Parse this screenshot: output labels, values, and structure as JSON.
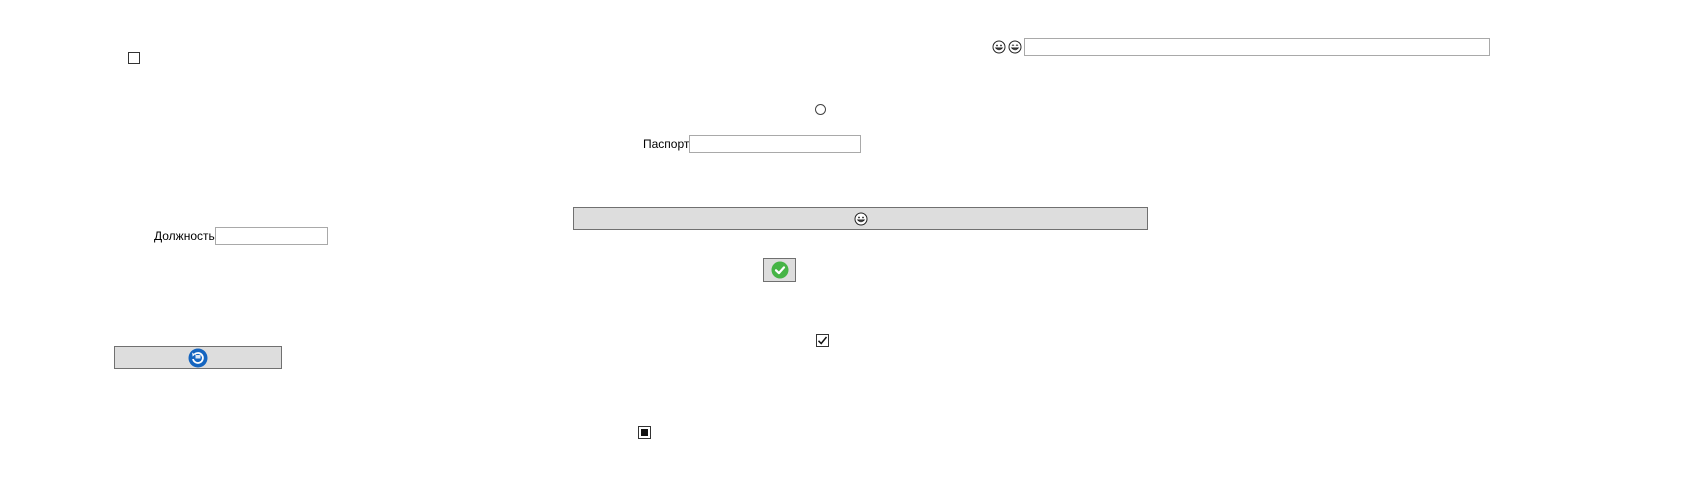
{
  "checkbox_top_left": {
    "checked": false
  },
  "radio_center": {
    "selected": false
  },
  "passport": {
    "label": "Паспорт",
    "value": ""
  },
  "position": {
    "label": "Должность",
    "value": ""
  },
  "top_search": {
    "value": "",
    "icons": [
      "grinning-face-icon",
      "grinning-face-icon"
    ]
  },
  "wide_button": {
    "icon": "grinning-face-icon"
  },
  "ok_button": {
    "icon": "green-check-circle-icon",
    "color": "#46b446"
  },
  "refresh_button": {
    "icon": "blue-refresh-circle-icon",
    "color": "#1565c0"
  },
  "checkbox_checked": {
    "checked": true
  },
  "checkbox_indeterminate": {
    "state": "indeterminate"
  }
}
